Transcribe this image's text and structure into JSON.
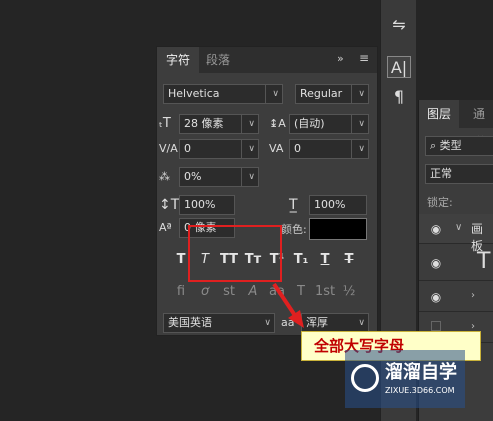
{
  "char_panel": {
    "tabs": [
      "字符",
      "段落"
    ],
    "menu_icon": "panel-menu-icon",
    "font_family": "Helvetica",
    "font_style": "Regular",
    "font_size": "28 像素",
    "leading": "(自动)",
    "kerning": "0",
    "tracking": "0",
    "tsume": "0%",
    "vertical_scale": "100%",
    "horizontal_scale": "100%",
    "baseline_shift": "0 像素",
    "color_label": "颜色:",
    "color_value": "#000000",
    "type_buttons": [
      "T",
      "T",
      "TT",
      "Tт",
      "T¹",
      "T₁",
      "T",
      "T"
    ],
    "opentype_buttons": [
      "fi",
      "ơ",
      "st",
      "A",
      "aa",
      "T",
      "1st",
      "½"
    ],
    "language": "美国英语",
    "aa_label": "aa",
    "antialias": "浑厚"
  },
  "layers_panel": {
    "tabs": [
      "图层",
      "通道"
    ],
    "filter_label": "类型",
    "blend_mode": "正常",
    "lock_label": "锁定:",
    "group_label": "画板"
  },
  "tooltip": {
    "text": "全部大写字母"
  },
  "watermark": {
    "title": "溜溜自学",
    "url": "ZIXUE.3D66.COM"
  }
}
